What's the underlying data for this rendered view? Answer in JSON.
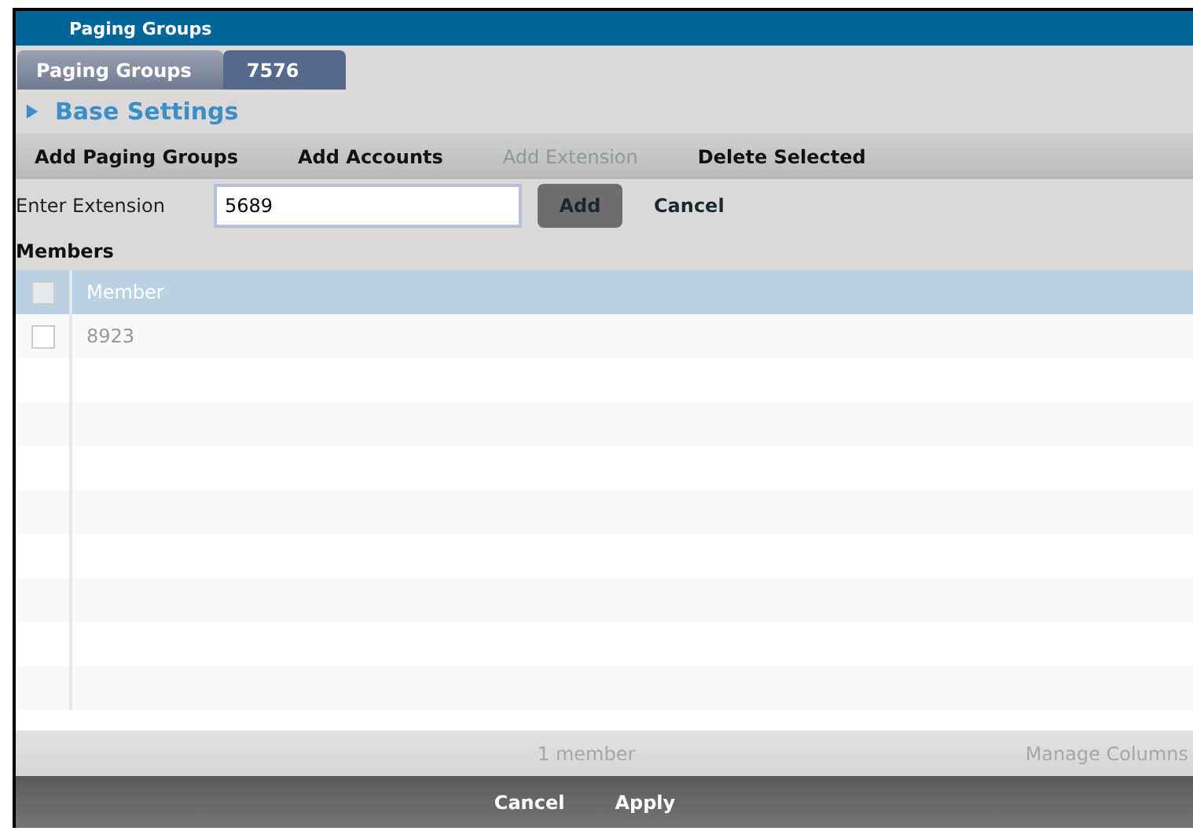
{
  "window": {
    "title": "Paging Groups"
  },
  "tabs": [
    {
      "label": "Paging Groups",
      "selected": false
    },
    {
      "label": "7576",
      "selected": true
    }
  ],
  "section": {
    "label": "Base Settings",
    "expanded": false
  },
  "toolbar": [
    {
      "label": "Add Paging Groups",
      "disabled": false
    },
    {
      "label": "Add Accounts",
      "disabled": false
    },
    {
      "label": "Add Extension",
      "disabled": true
    },
    {
      "label": "Delete Selected",
      "disabled": false
    }
  ],
  "extension_form": {
    "label": "Enter Extension",
    "value": "5689",
    "add": "Add",
    "cancel": "Cancel"
  },
  "members": {
    "heading": "Members",
    "column": "Member",
    "all_checked": false,
    "rows": [
      {
        "member": "8923",
        "checked": false
      }
    ],
    "count": "1 member",
    "manage": "Manage Columns"
  },
  "footer_buttons": [
    "Cancel",
    "Apply"
  ]
}
